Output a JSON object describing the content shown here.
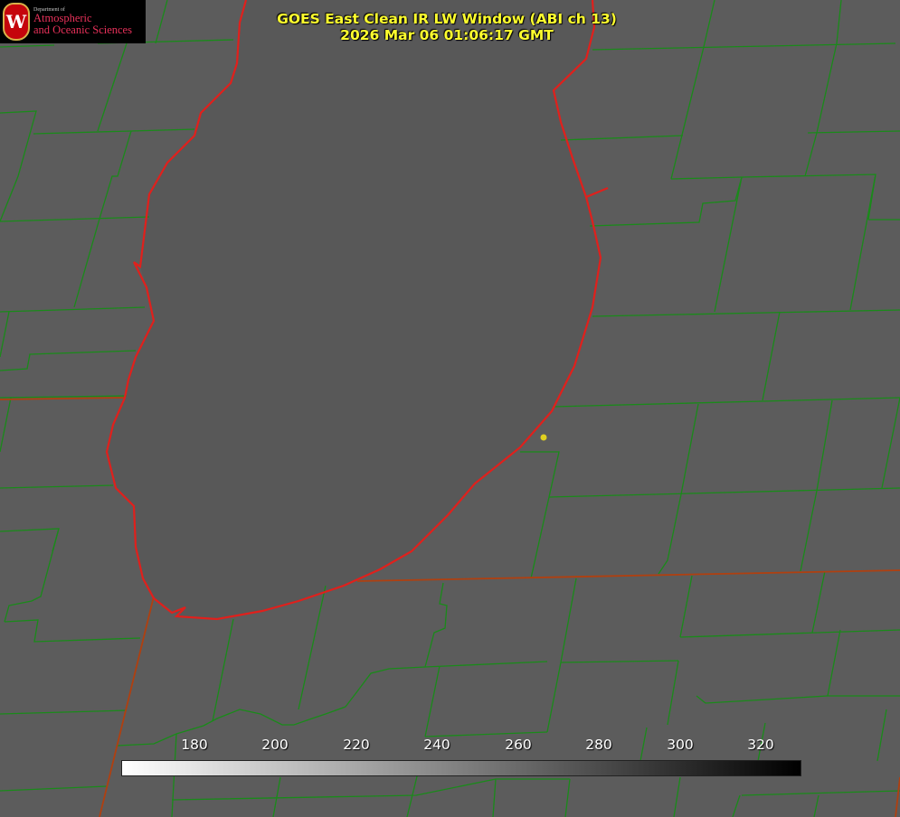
{
  "title": {
    "line1": "GOES East Clean IR LW Window (ABI ch 13)",
    "line2": "2026 Mar 06 01:06:17 GMT"
  },
  "logo": {
    "seal_letter": "W",
    "department": "Department of",
    "line1": "Atmospheric",
    "line2": "and Oceanic Sciences"
  },
  "colorbar": {
    "ticks": [
      "180",
      "200",
      "220",
      "240",
      "260",
      "280",
      "300",
      "320"
    ],
    "gradient_start_color": "#ffffff",
    "gradient_end_color": "#000000"
  },
  "map": {
    "background_color": "#5c5c5c",
    "lake_color": "#585858",
    "county_line_color": "#1a8a1a",
    "coast_line_color": "#e0201c",
    "state_line_color": "#b04010",
    "marker_color": "#e0d020"
  }
}
